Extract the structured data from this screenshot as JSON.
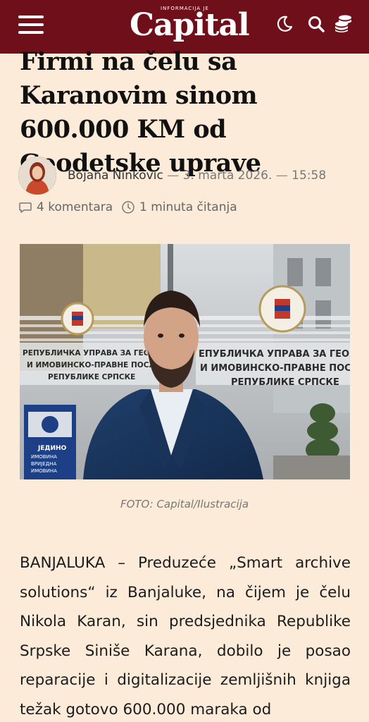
{
  "header": {
    "menu_icon": "hamburger-menu-icon",
    "logo_superscript": "INFORMACIJA JE",
    "logo_text": "Capital",
    "icons": [
      "moon-icon",
      "search-icon",
      "coins-icon"
    ],
    "background_color": "#6e0f19"
  },
  "article": {
    "headline": "Firmi na čelu sa Karanovim sinom 600.000 KM od Geodetske uprave",
    "author": "Bojana Ninkovic",
    "separator": "—",
    "date": "3. marta 2026.",
    "time": "15:58",
    "comments": "4 komentara",
    "reading_time": "1 minuta čitanja",
    "photo_sign_text": [
      "РЕПУБЛИЧКА УПРАВА ЗА ГЕОДЕТСКЕ",
      "И ИМОВИНСКО-ПРАВНЕ ПОСЛОВЕ",
      "РЕПУБЛИКЕ СРПСКЕ"
    ],
    "photo_sign_text_right": [
      "ЕПУБЛИЧКА УПРАВА ЗА ГЕОД",
      "И ИМОВИНСКО-ПРАВНЕ ПОСЛ",
      "РЕПУБЛИКЕ СРПСКЕ"
    ],
    "photo_poster_text": [
      "ЈЕДИНО",
      "ИМОВИНА",
      "ВРИЈЕДНА",
      "ИМОВИНА"
    ],
    "photo_caption": "FOTO: Capital/Ilustracija",
    "body": "BANJALUKA – Preduzeće „Smart archive solutions“ iz Banjaluke, na čijem je čelu Nikola Karan, sin predsjednika Republike Srpske Siniše Karana, dobilo je posao reparacije i digitalizacije zemljišnih knjiga težak gotovo 600.000 maraka od"
  },
  "colors": {
    "page_background": "#fcebd8",
    "brand": "#6e0f19"
  }
}
